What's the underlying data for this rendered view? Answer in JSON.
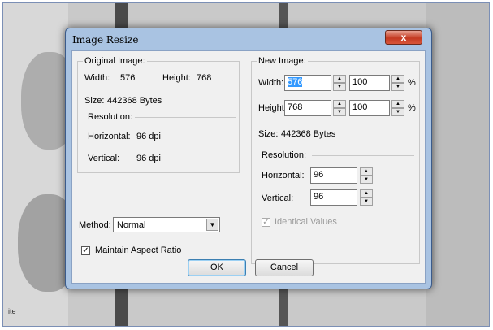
{
  "window": {
    "title": "Image Resize",
    "close_label": "x"
  },
  "background": {
    "text_fragment": "ite"
  },
  "original": {
    "legend": "Original Image:",
    "width_label": "Width:",
    "width_value": "576",
    "height_label": "Height:",
    "height_value": "768",
    "size_label": "Size:",
    "size_value": "442368 Bytes",
    "resolution_legend": "Resolution:",
    "horizontal_label": "Horizontal:",
    "horizontal_value": "96 dpi",
    "vertical_label": "Vertical:",
    "vertical_value": "96 dpi"
  },
  "new_image": {
    "legend": "New Image:",
    "width_label": "Width:",
    "width_value": "576",
    "width_percent": "100",
    "height_label": "Height:",
    "height_value": "768",
    "height_percent": "100",
    "percent_symbol": "%",
    "size_label": "Size:",
    "size_value": "442368 Bytes",
    "resolution_legend": "Resolution:",
    "horizontal_label": "Horizontal:",
    "horizontal_value": "96",
    "vertical_label": "Vertical:",
    "vertical_value": "96",
    "identical_label": "Identical Values",
    "identical_checked": true
  },
  "method": {
    "label": "Method:",
    "value": "Normal"
  },
  "aspect": {
    "label": "Maintain Aspect Ratio",
    "checked": true
  },
  "buttons": {
    "ok": "OK",
    "cancel": "Cancel"
  },
  "icons": {
    "check": "✓",
    "up": "▲",
    "down": "▼"
  }
}
